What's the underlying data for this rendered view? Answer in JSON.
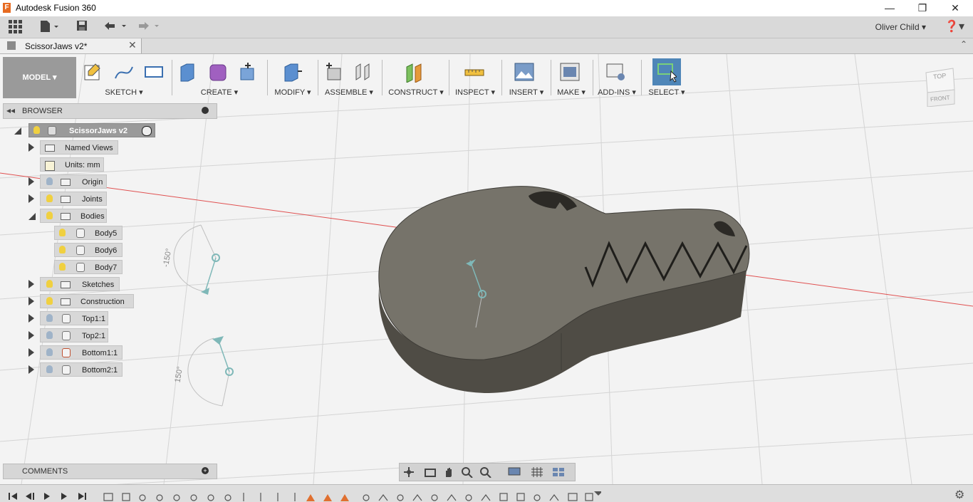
{
  "window": {
    "title": "Autodesk Fusion 360",
    "logo_letter": "F"
  },
  "appbar": {
    "user_name": "Oliver Child",
    "help_icon": "question-icon"
  },
  "document_tab": {
    "label": "ScissorJaws v2*"
  },
  "toolbar": {
    "workspace": "MODEL",
    "groups": [
      {
        "label": "SKETCH"
      },
      {
        "label": "CREATE"
      },
      {
        "label": "MODIFY"
      },
      {
        "label": "ASSEMBLE"
      },
      {
        "label": "CONSTRUCT"
      },
      {
        "label": "INSPECT"
      },
      {
        "label": "INSERT"
      },
      {
        "label": "MAKE"
      },
      {
        "label": "ADD-INS"
      },
      {
        "label": "SELECT"
      }
    ]
  },
  "browser": {
    "header": "BROWSER",
    "root": "ScissorJaws v2",
    "items": [
      {
        "label": "Named Views"
      },
      {
        "label": "Units: mm"
      },
      {
        "label": "Origin"
      },
      {
        "label": "Joints"
      },
      {
        "label": "Bodies"
      },
      {
        "label": "Body5"
      },
      {
        "label": "Body6"
      },
      {
        "label": "Body7"
      },
      {
        "label": "Sketches"
      },
      {
        "label": "Construction"
      },
      {
        "label": "Top1:1"
      },
      {
        "label": "Top2:1"
      },
      {
        "label": "Bottom1:1"
      },
      {
        "label": "Bottom2:1"
      }
    ]
  },
  "comments": {
    "header": "COMMENTS"
  },
  "viewcube": {
    "top": "TOP",
    "front": "FRONT"
  },
  "viewport": {
    "angle_top": "-150°",
    "angle_bottom": "150°"
  },
  "colors": {
    "body_fill": "#76736a",
    "body_side": "#4f4c45",
    "accent": "#4f86b8",
    "red_axis": "#e05050"
  }
}
